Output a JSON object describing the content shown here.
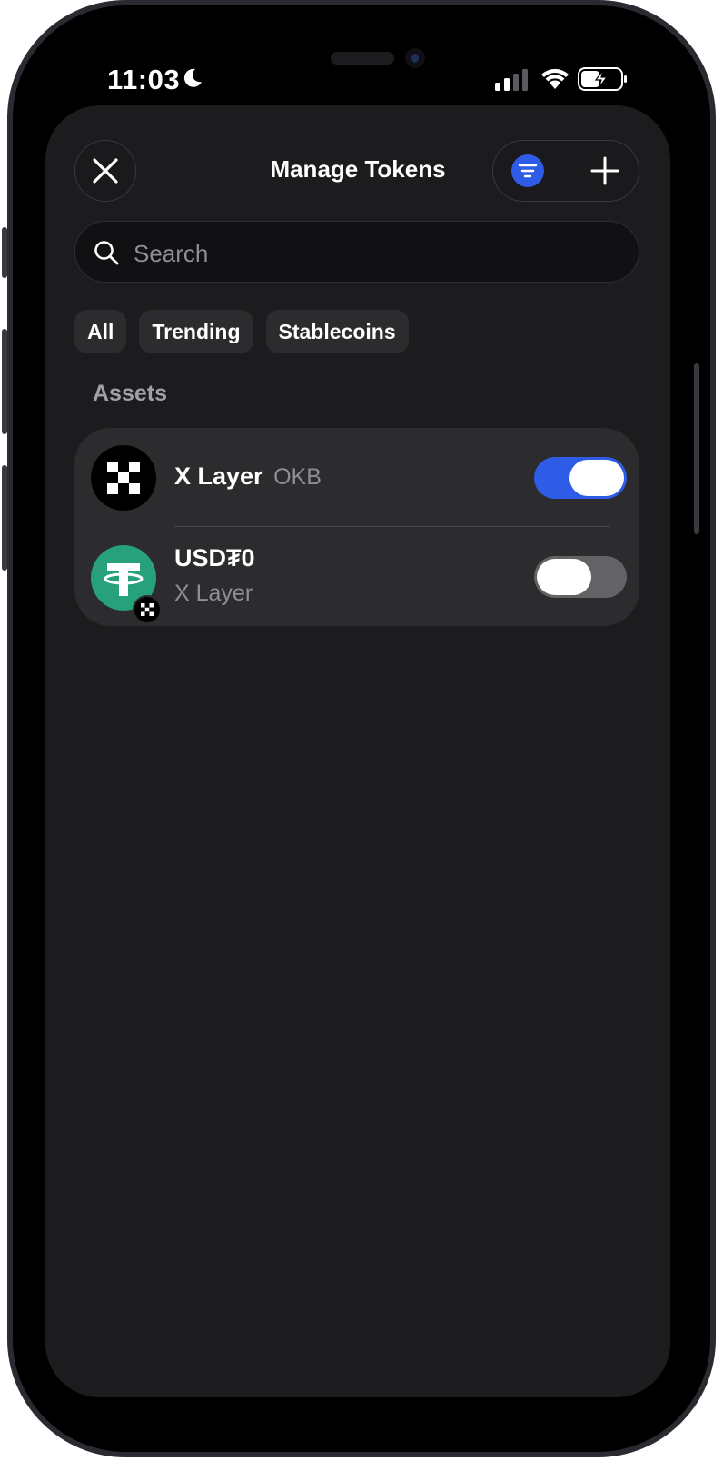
{
  "status_bar": {
    "time": "11:03",
    "icons": [
      "moon-icon",
      "cellular-signal-icon",
      "wifi-icon",
      "battery-charging-icon"
    ]
  },
  "header": {
    "title": "Manage Tokens",
    "close_icon": "close-icon",
    "filter_icon": "filter-icon",
    "add_icon": "plus-icon"
  },
  "search": {
    "placeholder": "Search",
    "value": ""
  },
  "filters": {
    "chips": [
      "All",
      "Trending",
      "Stablecoins"
    ]
  },
  "assets": {
    "section_label": "Assets",
    "items": [
      {
        "name": "X Layer",
        "symbol": "OKB",
        "enabled": true
      },
      {
        "name": "USD₮0",
        "network": "X Layer",
        "enabled": false
      }
    ]
  },
  "colors": {
    "accent": "#2e5ce6",
    "sheet_bg": "#1c1c1e",
    "card_bg": "#2c2c2e",
    "tether_green": "#26a17b",
    "toggle_off": "#636366"
  }
}
